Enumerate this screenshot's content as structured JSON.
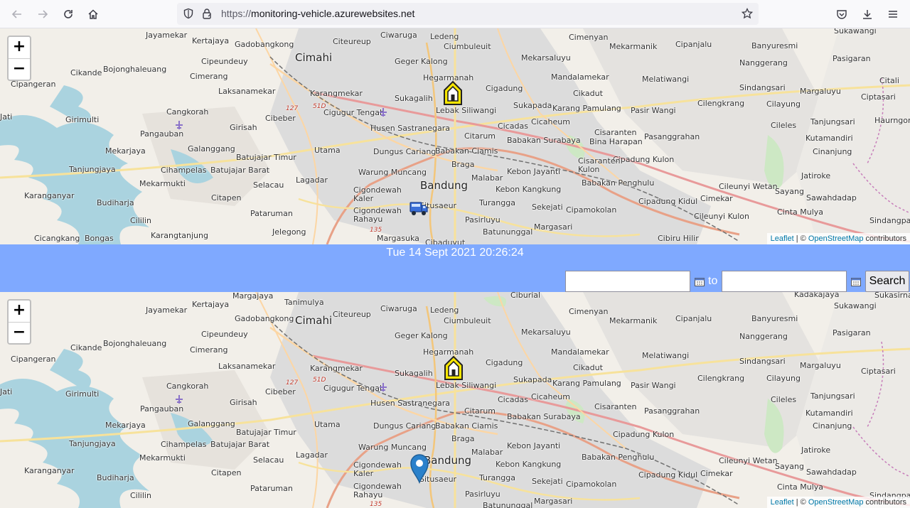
{
  "browser": {
    "url_scheme": "https://",
    "url_host": "monitoring-vehicle.azurewebsites.net",
    "icons": [
      "back-icon",
      "forward-icon",
      "reload-icon",
      "home-icon",
      "shield-icon",
      "lock-icon",
      "star-icon",
      "pocket-icon",
      "download-icon",
      "menu-icon"
    ]
  },
  "map": {
    "zoom_in": "+",
    "zoom_out": "−",
    "attribution": {
      "leaflet": "Leaflet",
      "separator": " | © ",
      "osm": "OpenStreetMap",
      "suffix": " contributors"
    },
    "places": {
      "jayamekar": "Jayamekar",
      "kertajaya": "Kertajaya",
      "gadobangkong": "Gadobangkong",
      "cimahi": "Cimahi",
      "citeureup": "Citeureup",
      "ciwaruga": "Ciwaruga",
      "ledeng": "Ledeng",
      "ciumbuleuit": "Ciumbuleuit",
      "cimenyan": "Cimenyan",
      "mekarmanik": "Mekarmanik",
      "cipanjalu": "Cipanjalu",
      "banyuresmi": "Banyuresmi",
      "sukawangi": "Sukawangi",
      "cipeundeuy": "Cipeundeuy",
      "geger_kalong": "Geger Kalong",
      "mekarsaluyu": "Mekarsaluyu",
      "nanggerang": "Nanggerang",
      "pasigaran": "Pasigaran",
      "cikande": "Cikande",
      "bojonghaleuang": "Bojonghaleuang",
      "cimerang": "Cimerang",
      "hegarmanah": "Hegarmanah",
      "mandalamekar": "Mandalamekar",
      "melatiwangi": "Melatiwangi",
      "citali": "Citali",
      "cipangeran": "Cipangeran",
      "laksanamekar": "Laksanamekar",
      "karangmekar": "Karangmekar",
      "sukagalih": "Sukagalih",
      "cigadung": "Cigadung",
      "cikadut": "Cikadut",
      "sindangsari": "Sindangsari",
      "margaluyu": "Margaluyu",
      "ciptasari": "Ciptasari",
      "cangkorah": "Cangkorah",
      "lebak_siliwangi": "Lebak Siliwangi",
      "sukapada": "Sukapada",
      "karang_pamulang": "Karang Pamulang",
      "pasir_wangi": "Pasir Wangi",
      "cilengkrang": "Cilengkrang",
      "cilayung": "Cilayung",
      "jati": "Jati",
      "girimulti": "Girimulti",
      "cibeber": "Cibeber",
      "cigugur_tengah": "Cigugur Tengah",
      "cicadas": "Cicadas",
      "cicaheum": "Cicaheum",
      "tanjungsari": "Tanjungsari",
      "haurngombong": "Haurngombong",
      "pangauban": "Pangauban",
      "girisah": "Girisah",
      "husen_sastranegara": "Husen Sastranegara",
      "citarum": "Citarum",
      "cisaranten": "Cisaranten",
      "pasanggrahan": "Pasanggrahan",
      "cileles": "Cileles",
      "kutamandiri": "Kutamandiri",
      "mekarjaya": "Mekarjaya",
      "galanggang": "Galanggang",
      "utama": "Utama",
      "dungus_cariang": "Dungus Cariang",
      "babakan_ciamis": "Babakan Ciamis",
      "babakan_surabaya": "Babakan Surabaya",
      "bina_harapan": "Bina Harapan",
      "cinanjung": "Cinanjung",
      "batujajar_timur": "Batujajar Timur",
      "braga": "Braga",
      "cipadung_kulon": "Cipadung Kulon",
      "tanjungjaya": "Tanjungjaya",
      "cihampelas": "Cihampelas",
      "batujajar_barat": "Batujajar Barat",
      "warung_muncang": "Warung Muncang",
      "malabar": "Malabar",
      "kebon_jayanti": "Kebon Jayanti",
      "cisaranten_kulon": "Cisaranten\nKulon",
      "jatiroke": "Jatiroke",
      "mekarmukti": "Mekarmukti",
      "selacau": "Selacau",
      "lagadar": "Lagadar",
      "bandung": "Bandung",
      "babakan_penghulu": "Babakan Penghulu",
      "cileunyi_wetan": "Cileunyi Wetan",
      "karanganyar": "Karanganyar",
      "cigondewah_kaler": "Cigondewah\nKaler",
      "kebon_kangkung": "Kebon Kangkung",
      "cipadung_kidul": "Cipadung Kidul",
      "cimekar": "Cimekar",
      "sayang": "Sayang",
      "sawahdadap": "Sawahdadap",
      "budiharja": "Budiharja",
      "citapen": "Citapen",
      "situsaeur": "Situsaeur",
      "turangga": "Turangga",
      "sekejati": "Sekejati",
      "cipamokolan": "Cipamokolan",
      "cileunyi_kulon": "Cileunyi Kulon",
      "cinta_mulya": "Cinta Mulya",
      "sindangpakon": "Sindangpako",
      "pataruman": "Pataruman",
      "cigondewah_rahayu": "Cigondewah\nRahayu",
      "pasirluyu": "Pasirluyu",
      "margasari": "Margasari",
      "cililin": "Cililin",
      "jelegong": "Jelegong",
      "cicangkang": "Cicangkang",
      "bongas": "Bongas",
      "karangtanjung": "Karangtanjung",
      "margasuka": "Margasuka",
      "batununggal": "Batununggal",
      "cibiru_hilir": "Cibiru Hilir",
      "cibaduyut": "Cibaduyut",
      "margajaya": "Margajaya",
      "tanimulya": "Tanimulya",
      "ciburial": "Ciburial",
      "kadakajaya": "Kadakajaya",
      "sukasirna": "Sukasirna",
      "road_127": "127",
      "road_51d": "51D",
      "road_135": "135"
    }
  },
  "controls": {
    "datetime": "Tue 14 Sept 2021 20:26:24",
    "from_value": "",
    "to_label": "to",
    "to_value": "",
    "search_label": "Search"
  }
}
